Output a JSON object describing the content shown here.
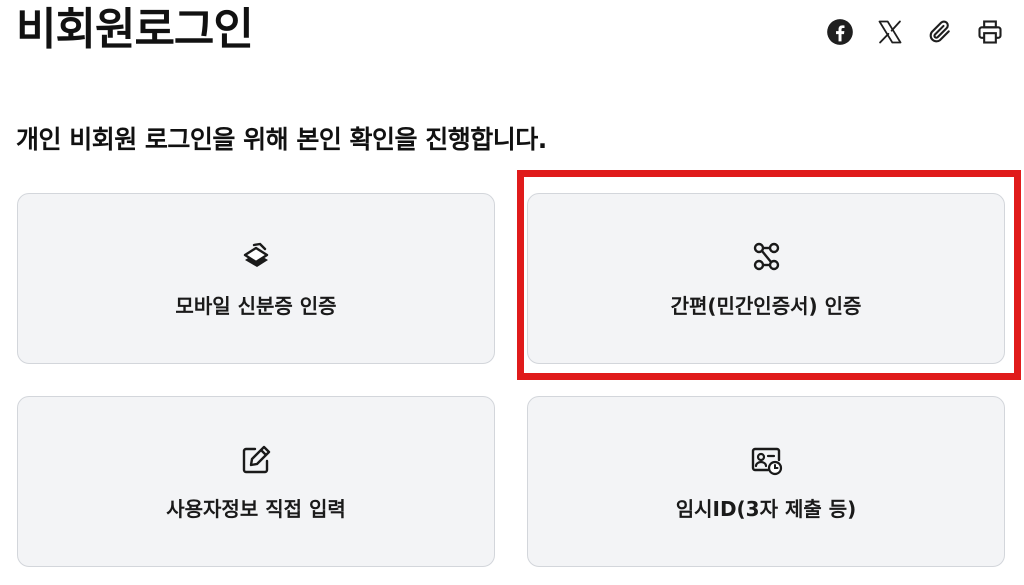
{
  "header": {
    "title": "비회원로그인",
    "share": [
      {
        "icon": "facebook-icon"
      },
      {
        "icon": "x-twitter-icon"
      },
      {
        "icon": "paperclip-icon"
      },
      {
        "icon": "printer-icon"
      }
    ]
  },
  "main": {
    "subtitle": "개인 비회원 로그인을 위해 본인 확인을 진행합니다.",
    "options": [
      {
        "label": "모바일 신분증 인증",
        "icon": "mobile-id-layers-icon"
      },
      {
        "label": "간편(민간인증서) 인증",
        "icon": "simple-auth-nodes-icon"
      },
      {
        "label": "사용자정보 직접 입력",
        "icon": "edit-pencil-icon"
      },
      {
        "label": "임시ID(3자 제출 등)",
        "icon": "temporary-id-card-icon"
      }
    ]
  },
  "colors": {
    "highlight": "#e01b1b",
    "card_bg": "#f3f4f6",
    "card_border": "#d3d6db",
    "text": "#111111"
  }
}
